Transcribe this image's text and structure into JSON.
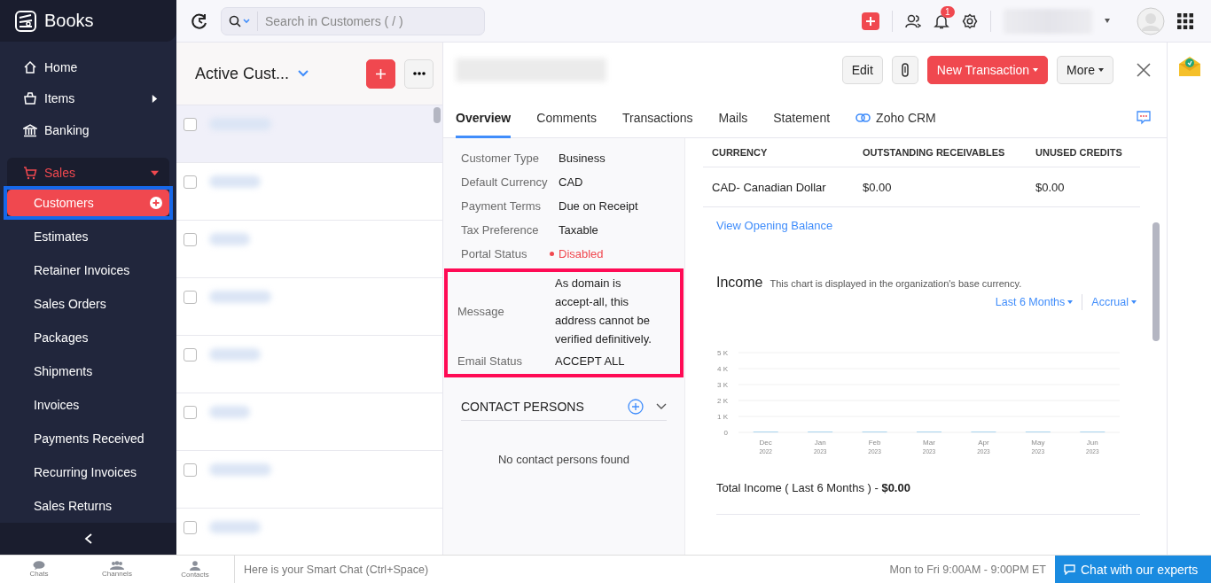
{
  "app": {
    "name": "Books"
  },
  "sidebar": {
    "items": [
      {
        "label": "Home",
        "selected": false
      },
      {
        "label": "Items",
        "selected": false,
        "has_submenu": true
      },
      {
        "label": "Banking",
        "selected": false
      },
      {
        "label": "Sales",
        "selected": false,
        "expanded": true,
        "children": [
          {
            "label": "Customers",
            "selected": true,
            "highlighted": true,
            "has_add": true
          },
          {
            "label": "Estimates",
            "selected": false,
            "highlighted": false
          },
          {
            "label": "Retainer Invoices",
            "selected": false,
            "highlighted": false
          },
          {
            "label": "Sales Orders",
            "selected": false,
            "highlighted": false
          },
          {
            "label": "Packages",
            "selected": false,
            "highlighted": false
          },
          {
            "label": "Shipments",
            "selected": false,
            "highlighted": false
          },
          {
            "label": "Invoices",
            "selected": false,
            "highlighted": false
          },
          {
            "label": "Payments Received",
            "selected": false,
            "highlighted": false
          },
          {
            "label": "Recurring Invoices",
            "selected": false,
            "highlighted": false
          },
          {
            "label": "Sales Returns",
            "selected": false,
            "highlighted": false
          }
        ]
      }
    ]
  },
  "header": {
    "search": {
      "placeholder": "Search in Customers ( / )"
    },
    "notification_count": "1"
  },
  "list": {
    "title": "Active Cust...",
    "rows": [
      {
        "checked": false,
        "selected": true
      },
      {
        "checked": false,
        "selected": false
      },
      {
        "checked": false,
        "selected": false
      },
      {
        "checked": false,
        "selected": false
      },
      {
        "checked": false,
        "selected": false
      },
      {
        "checked": false,
        "selected": false
      },
      {
        "checked": false,
        "selected": false
      },
      {
        "checked": false,
        "selected": false
      }
    ]
  },
  "detail": {
    "buttons": [
      "Edit",
      "New Transaction",
      "More"
    ],
    "tabs": [
      {
        "label": "Overview",
        "selected": true,
        "kind": "plain"
      },
      {
        "label": "Comments",
        "selected": false,
        "kind": "plain"
      },
      {
        "label": "Transactions",
        "selected": false,
        "kind": "plain"
      },
      {
        "label": "Mails",
        "selected": false,
        "kind": "plain"
      },
      {
        "label": "Statement",
        "selected": false,
        "kind": "plain"
      },
      {
        "label": "Zoho CRM",
        "selected": false,
        "kind": "linked"
      }
    ],
    "fields": [
      {
        "label": "Customer Type",
        "value": "Business",
        "kind": "text",
        "highlighted": false
      },
      {
        "label": "Default Currency",
        "value": "CAD",
        "kind": "text",
        "highlighted": false
      },
      {
        "label": "Payment Terms",
        "value": "Due on Receipt",
        "kind": "text",
        "highlighted": false
      },
      {
        "label": "Tax Preference",
        "value": "Taxable",
        "kind": "text",
        "highlighted": false
      },
      {
        "label": "Portal Status",
        "value": "Disabled",
        "kind": "status",
        "highlighted": false
      },
      {
        "label": "Message",
        "value": "As domain is accept-all, this address cannot be verified definitively.",
        "kind": "text",
        "highlighted": true
      },
      {
        "label": "Email Status",
        "value": "ACCEPT ALL",
        "kind": "text",
        "highlighted": true
      }
    ],
    "contact_persons": {
      "title": "CONTACT PERSONS",
      "empty_text": "No contact persons found"
    },
    "balances": {
      "columns": [
        "CURRENCY",
        "OUTSTANDING RECEIVABLES",
        "UNUSED CREDITS"
      ],
      "rows": [
        [
          "CAD- Canadian Dollar",
          "$0.00",
          "$0.00"
        ]
      ],
      "link": "View Opening Balance"
    },
    "income": {
      "title": "Income",
      "note": "This chart is displayed in the organization's base currency.",
      "filters": [
        "Last 6 Months",
        "Accrual"
      ],
      "chart_data": {
        "type": "bar",
        "categories": [
          "Dec $_{2022}$",
          "Jan $_{2023}$",
          "Feb $_{2023}$",
          "Mar $_{2023}$",
          "Apr $_{2023}$",
          "May $_{2023}$",
          "Jun $_{2023}$"
        ],
        "values": [
          0,
          0,
          0,
          0,
          0,
          0,
          0
        ],
        "ylim": [
          0,
          5000
        ],
        "grid": true,
        "yticks": [
          {
            "value": 0,
            "label": "0"
          },
          {
            "value": 1000,
            "label": "1 K"
          },
          {
            "value": 2000,
            "label": "2 K"
          },
          {
            "value": 3000,
            "label": "3 K"
          },
          {
            "value": 4000,
            "label": "4 K"
          },
          {
            "value": 5000,
            "label": "5 K"
          }
        ]
      },
      "total": "Total Income ( Last 6 Months ) - **$0.00**"
    }
  },
  "bottom_bar": {
    "tabs": [
      "Chats",
      "Channels",
      "Contacts"
    ],
    "chat_placeholder": "Here is your Smart Chat (Ctrl+Space)",
    "hours": "Mon to Fri 9:00AM - 9:00PM ET",
    "button": "Chat with our experts"
  }
}
